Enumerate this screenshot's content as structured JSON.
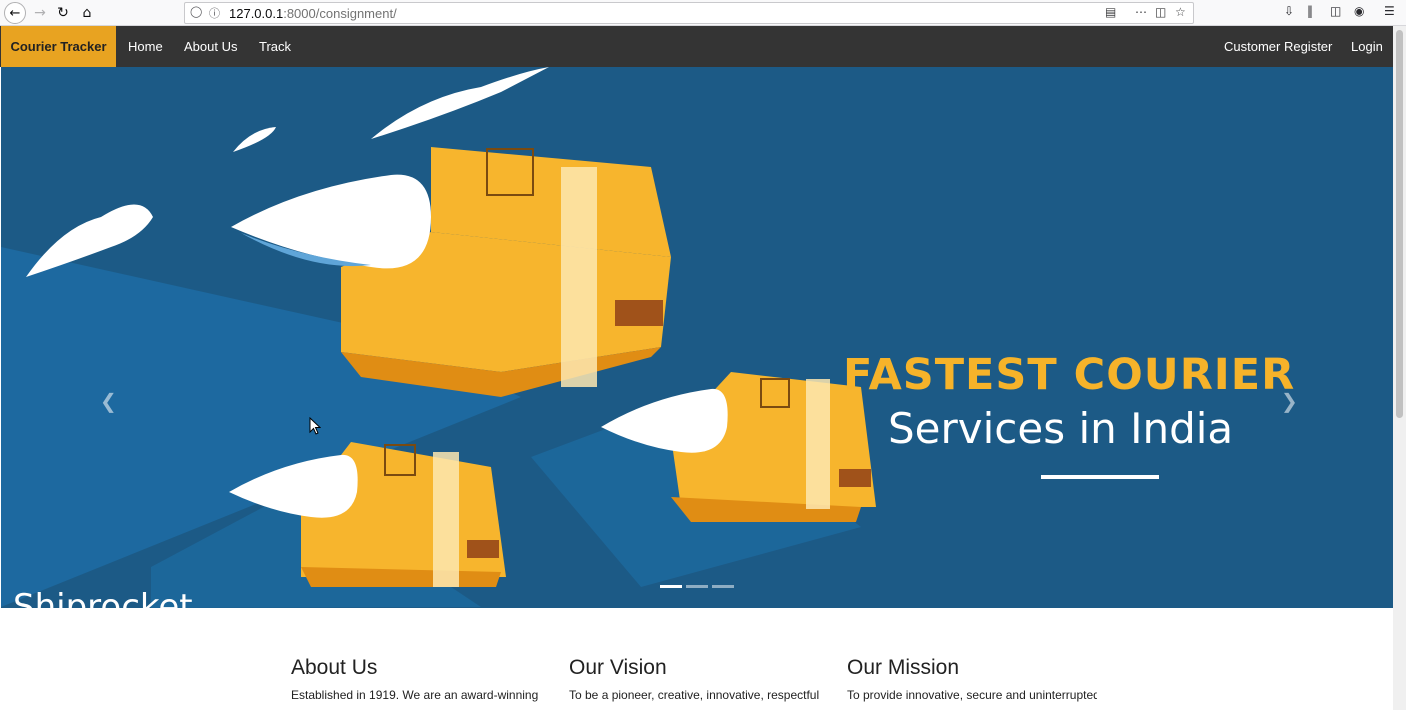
{
  "browser": {
    "url_host": "127.0.0.1",
    "url_path": ":8000/consignment/"
  },
  "navbar": {
    "brand": "Courier Tracker",
    "links": [
      "Home",
      "About Us",
      "Track"
    ],
    "right_links": [
      "Customer Register",
      "Login"
    ]
  },
  "hero": {
    "title": "FASTEST COURIER",
    "subtitle": "Services in India",
    "watermark": "Shiprocket",
    "slides": 3,
    "active_slide": 1
  },
  "sections": [
    {
      "title": "About Us",
      "text": "Established in 1919. We are an award-winning"
    },
    {
      "title": "Our Vision",
      "text": "To be a pioneer, creative, innovative, respectful"
    },
    {
      "title": "Our Mission",
      "text": "To provide innovative, secure and uninterrupted"
    }
  ],
  "colors": {
    "brand_bg": "#e8a321",
    "navbar_bg": "#343434",
    "hero_bg": "#1c5a86",
    "hero_title": "#f6b32a"
  }
}
